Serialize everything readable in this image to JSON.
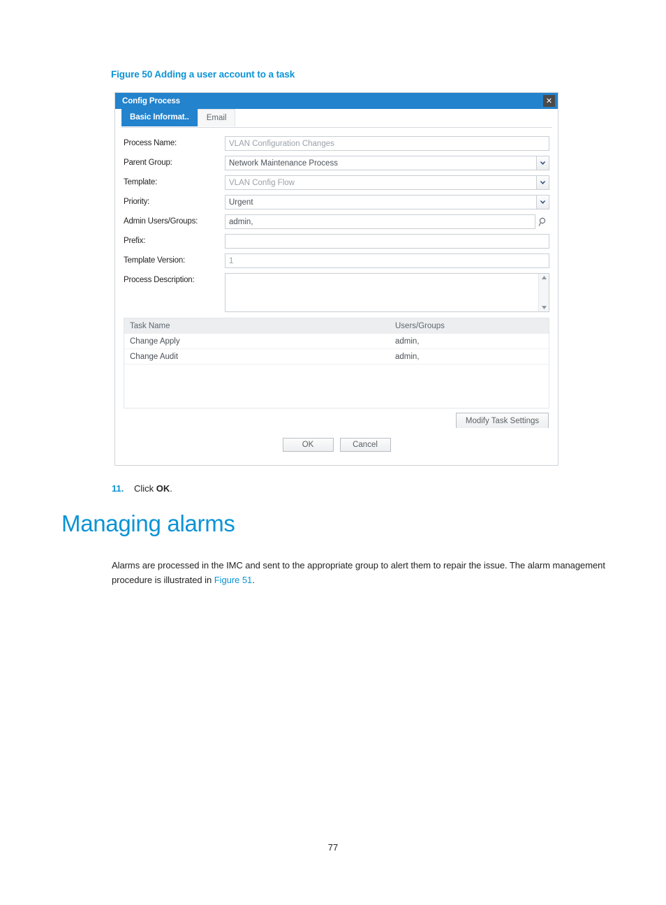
{
  "figure": {
    "caption": "Figure 50 Adding a user account to a task"
  },
  "dialog": {
    "title": "Config Process",
    "close_icon": "close-icon",
    "tabs": [
      {
        "label": "Basic Informat..",
        "active": true
      },
      {
        "label": "Email",
        "active": false
      }
    ],
    "fields": [
      {
        "label": "Process Name:",
        "value": "VLAN Configuration Changes",
        "type": "text",
        "disabled": true
      },
      {
        "label": "Parent Group:",
        "value": "Network Maintenance Process",
        "type": "select",
        "disabled": false
      },
      {
        "label": "Template:",
        "value": "VLAN Config Flow",
        "type": "select",
        "disabled": true
      },
      {
        "label": "Priority:",
        "value": "Urgent",
        "type": "select",
        "disabled": false
      },
      {
        "label": "Admin Users/Groups:",
        "value": "admin,",
        "type": "text-search",
        "disabled": false
      },
      {
        "label": "Prefix:",
        "value": "",
        "type": "text",
        "disabled": false
      },
      {
        "label": "Template Version:",
        "value": "1",
        "type": "text",
        "disabled": true
      },
      {
        "label": "Process Description:",
        "value": "",
        "type": "textarea",
        "disabled": false
      }
    ],
    "task_table": {
      "columns": [
        "Task Name",
        "Users/Groups"
      ],
      "rows": [
        [
          "Change Apply",
          "admin,"
        ],
        [
          "Change Audit",
          "admin,"
        ]
      ]
    },
    "buttons": {
      "modify": "Modify Task Settings",
      "ok": "OK",
      "cancel": "Cancel"
    }
  },
  "content": {
    "step_number": "11.",
    "step_text_before": "Click ",
    "step_bold": "OK",
    "step_text_after": ".",
    "heading": "Managing alarms",
    "paragraph_before": "Alarms are processed in the IMC and sent to the appropriate group to alert them to repair the issue. The alarm management procedure is illustrated in ",
    "paragraph_link": "Figure 51",
    "paragraph_after": ".",
    "page_number": "77"
  },
  "colors": {
    "brand_blue": "#0b93d5",
    "titlebar_blue": "#2383cd"
  }
}
